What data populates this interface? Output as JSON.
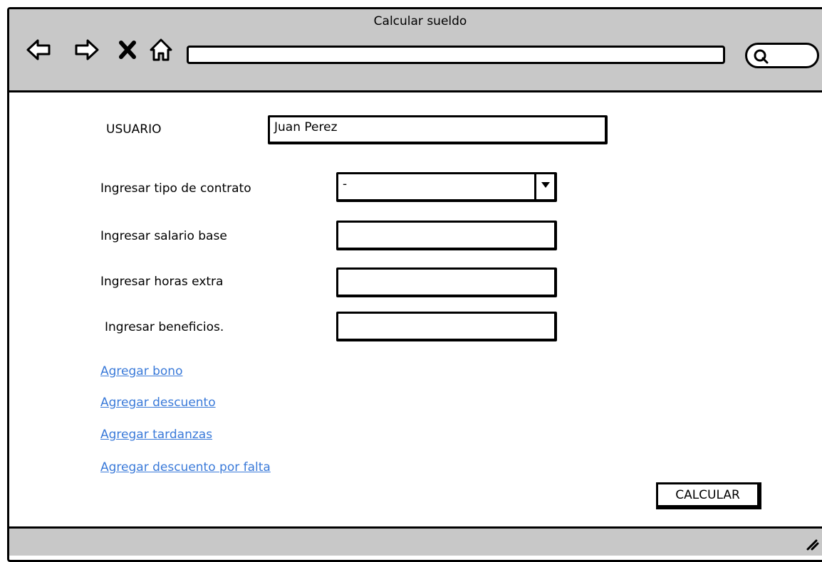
{
  "window": {
    "title": "Calcular sueldo"
  },
  "toolbar": {
    "icons": [
      "back-arrow-icon",
      "forward-arrow-icon",
      "close-icon",
      "home-icon"
    ],
    "address_value": "",
    "search_icon": "search-icon"
  },
  "form": {
    "user_label": "USUARIO",
    "user_value": "Juan Perez",
    "contract_label": "Ingresar tipo de contrato",
    "contract_value": "-",
    "salary_label": "Ingresar salario base",
    "salary_value": "",
    "overtime_label": "Ingresar horas extra",
    "overtime_value": "",
    "benefits_label": "Ingresar beneficios.",
    "benefits_value": ""
  },
  "links": {
    "bonus": "Agregar bono",
    "discount": "Agregar descuento",
    "tardiness": "Agregar tardanzas",
    "absence_discount": "Agregar descuento por falta"
  },
  "actions": {
    "calculate_label": "CALCULAR"
  },
  "colors": {
    "chrome": "#c8c8c8",
    "link": "#3a7ad9"
  }
}
